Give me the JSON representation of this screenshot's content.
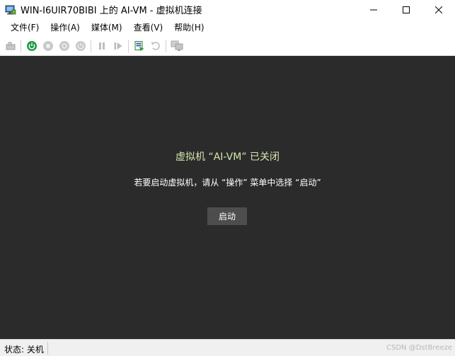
{
  "window": {
    "title": "WIN-I6UIR70BIBI 上的 AI-VM - 虚拟机连接"
  },
  "menu": {
    "items": [
      "文件(F)",
      "操作(A)",
      "媒体(M)",
      "查看(V)",
      "帮助(H)"
    ]
  },
  "toolbar": {
    "icons": [
      "ctrl-alt-del-icon",
      "start-icon",
      "turn-off-icon",
      "shut-down-icon",
      "save-icon",
      "pause-icon",
      "resume-icon",
      "checkpoint-icon",
      "revert-icon",
      "enhanced-session-icon"
    ]
  },
  "vm": {
    "title": "虚拟机 “AI-VM” 已关闭",
    "message": "若要启动虚拟机，请从 “操作” 菜单中选择 “启动”",
    "start_button": "启动"
  },
  "status": {
    "text": "状态: 关机",
    "watermark": "CSDN @DstBreeze"
  },
  "colors": {
    "vm_background": "#2b2b2b",
    "vm_title": "#d6e6b0",
    "start_icon_green": "#1e9c4b"
  }
}
